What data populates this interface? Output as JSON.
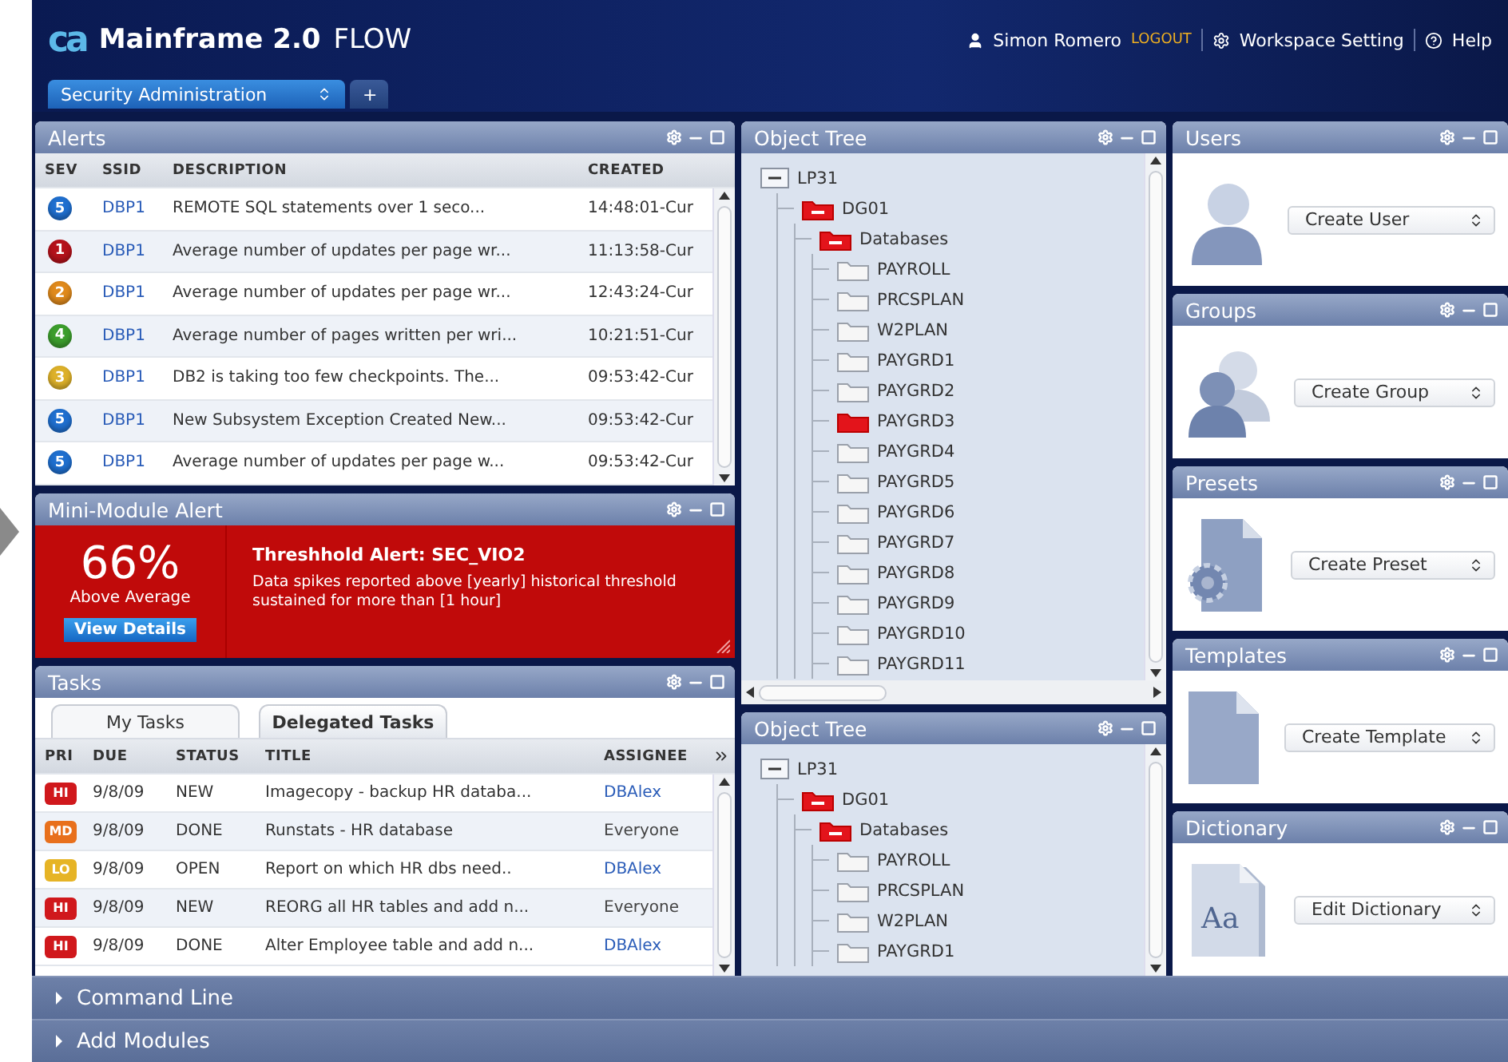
{
  "header": {
    "logo": "ca",
    "title": "Mainframe 2.0",
    "subtitle": "FLOW",
    "user": "Simon Romero",
    "logout": "LOGOUT",
    "settings": "Workspace Setting",
    "help": "Help"
  },
  "workspace_tabs": [
    {
      "label": "Security Administration",
      "kind": "dropdown",
      "selected": true
    },
    {
      "label": "+",
      "kind": "add",
      "selected": false
    }
  ],
  "alerts": {
    "title": "Alerts",
    "columns": [
      "SEV",
      "SSID",
      "DESCRIPTION",
      "CREATED"
    ],
    "rows": [
      {
        "sev": "5",
        "color": "#1f6fcf",
        "ssid": "DBP1",
        "description": "REMOTE SQL statements over 1 seco...",
        "created": "14:48:01-Cur"
      },
      {
        "sev": "1",
        "color": "#b5121b",
        "ssid": "DBP1",
        "description": "Average number of updates per page wr...",
        "created": "11:13:58-Cur"
      },
      {
        "sev": "2",
        "color": "#e08a1c",
        "ssid": "DBP1",
        "description": "Average number of updates per page wr...",
        "created": "12:43:24-Cur"
      },
      {
        "sev": "4",
        "color": "#3c9e2c",
        "ssid": "DBP1",
        "description": "Average number of pages written per wri...",
        "created": "10:21:51-Cur"
      },
      {
        "sev": "3",
        "color": "#ddb12a",
        "ssid": "DBP1",
        "description": "DB2 is taking too few checkpoints. The...",
        "created": "09:53:42-Cur"
      },
      {
        "sev": "5",
        "color": "#1f6fcf",
        "ssid": "DBP1",
        "description": "New Subsystem Exception Created New...",
        "created": "09:53:42-Cur"
      },
      {
        "sev": "5",
        "color": "#1f6fcf",
        "ssid": "DBP1",
        "description": "Average number of updates per page w...",
        "created": "09:53:42-Cur"
      }
    ]
  },
  "mini_alert": {
    "title": "Mini-Module Alert",
    "percent": "66%",
    "caption": "Above Average",
    "button": "View Details",
    "heading": "Threshhold Alert: SEC_VIO2",
    "message": "Data spikes reported above [yearly] historical threshold sustained for more than [1 hour]"
  },
  "tasks": {
    "title": "Tasks",
    "tabs": [
      {
        "label": "My Tasks",
        "selected": false
      },
      {
        "label": "Delegated Tasks",
        "selected": true
      }
    ],
    "columns": [
      "PRI",
      "DUE",
      "STATUS",
      "TITLE",
      "ASSIGNEE"
    ],
    "rows": [
      {
        "priority": "HI",
        "color": "#d0181c",
        "due": "9/8/09",
        "status": "NEW",
        "title": "Imagecopy - backup HR databa...",
        "assignee": "DBAlex",
        "link": true
      },
      {
        "priority": "MD",
        "color": "#e8701c",
        "due": "9/8/09",
        "status": "DONE",
        "title": "Runstats - HR database",
        "assignee": "Everyone",
        "link": false
      },
      {
        "priority": "LO",
        "color": "#e6b426",
        "due": "9/8/09",
        "status": "OPEN",
        "title": "Report on which HR dbs need..",
        "assignee": "DBAlex",
        "link": true
      },
      {
        "priority": "HI",
        "color": "#d0181c",
        "due": "9/8/09",
        "status": "NEW",
        "title": "REORG all HR tables and add n...",
        "assignee": "Everyone",
        "link": false
      },
      {
        "priority": "HI",
        "color": "#d0181c",
        "due": "9/8/09",
        "status": "DONE",
        "title": "Alter Employee table and add n...",
        "assignee": "DBAlex",
        "link": true
      }
    ]
  },
  "object_trees": [
    {
      "title": "Object Tree",
      "nodes": [
        {
          "label": "LP31",
          "kind": "system",
          "expanded": true,
          "children": [
            {
              "label": "DG01",
              "kind": "folder",
              "expanded": true,
              "children": [
                {
                  "label": "Databases",
                  "kind": "folder",
                  "expanded": true,
                  "children": [
                    {
                      "label": "PAYROLL",
                      "kind": "folder",
                      "selected": false
                    },
                    {
                      "label": "PRCSPLAN",
                      "kind": "folder",
                      "selected": false
                    },
                    {
                      "label": "W2PLAN",
                      "kind": "folder",
                      "selected": false
                    },
                    {
                      "label": "PAYGRD1",
                      "kind": "folder",
                      "selected": false
                    },
                    {
                      "label": "PAYGRD2",
                      "kind": "folder",
                      "selected": false
                    },
                    {
                      "label": "PAYGRD3",
                      "kind": "folder",
                      "selected": true
                    },
                    {
                      "label": "PAYGRD4",
                      "kind": "folder",
                      "selected": false
                    },
                    {
                      "label": "PAYGRD5",
                      "kind": "folder",
                      "selected": false
                    },
                    {
                      "label": "PAYGRD6",
                      "kind": "folder",
                      "selected": false
                    },
                    {
                      "label": "PAYGRD7",
                      "kind": "folder",
                      "selected": false
                    },
                    {
                      "label": "PAYGRD8",
                      "kind": "folder",
                      "selected": false
                    },
                    {
                      "label": "PAYGRD9",
                      "kind": "folder",
                      "selected": false
                    },
                    {
                      "label": "PAYGRD10",
                      "kind": "folder",
                      "selected": false
                    },
                    {
                      "label": "PAYGRD11",
                      "kind": "folder",
                      "selected": false
                    }
                  ]
                }
              ]
            }
          ]
        }
      ]
    },
    {
      "title": "Object Tree",
      "nodes": [
        {
          "label": "LP31",
          "kind": "system",
          "expanded": true,
          "children": [
            {
              "label": "DG01",
              "kind": "folder",
              "expanded": true,
              "children": [
                {
                  "label": "Databases",
                  "kind": "folder",
                  "expanded": true,
                  "children": [
                    {
                      "label": "PAYROLL",
                      "kind": "folder",
                      "selected": false
                    },
                    {
                      "label": "PRCSPLAN",
                      "kind": "folder",
                      "selected": false
                    },
                    {
                      "label": "W2PLAN",
                      "kind": "folder",
                      "selected": false
                    },
                    {
                      "label": "PAYGRD1",
                      "kind": "folder",
                      "selected": false
                    }
                  ]
                }
              ]
            }
          ]
        }
      ]
    }
  ],
  "side_panels": [
    {
      "title": "Users",
      "kind": "user",
      "action": "Create User"
    },
    {
      "title": "Groups",
      "kind": "group",
      "action": "Create Group"
    },
    {
      "title": "Presets",
      "kind": "preset",
      "action": "Create Preset"
    },
    {
      "title": "Templates",
      "kind": "template",
      "action": "Create Template"
    },
    {
      "title": "Dictionary",
      "kind": "dictionary",
      "action": "Edit Dictionary",
      "icon_label": "Aa"
    }
  ],
  "footer": [
    {
      "label": "Command Line",
      "expanded": false
    },
    {
      "label": "Add Modules",
      "expanded": false
    }
  ]
}
